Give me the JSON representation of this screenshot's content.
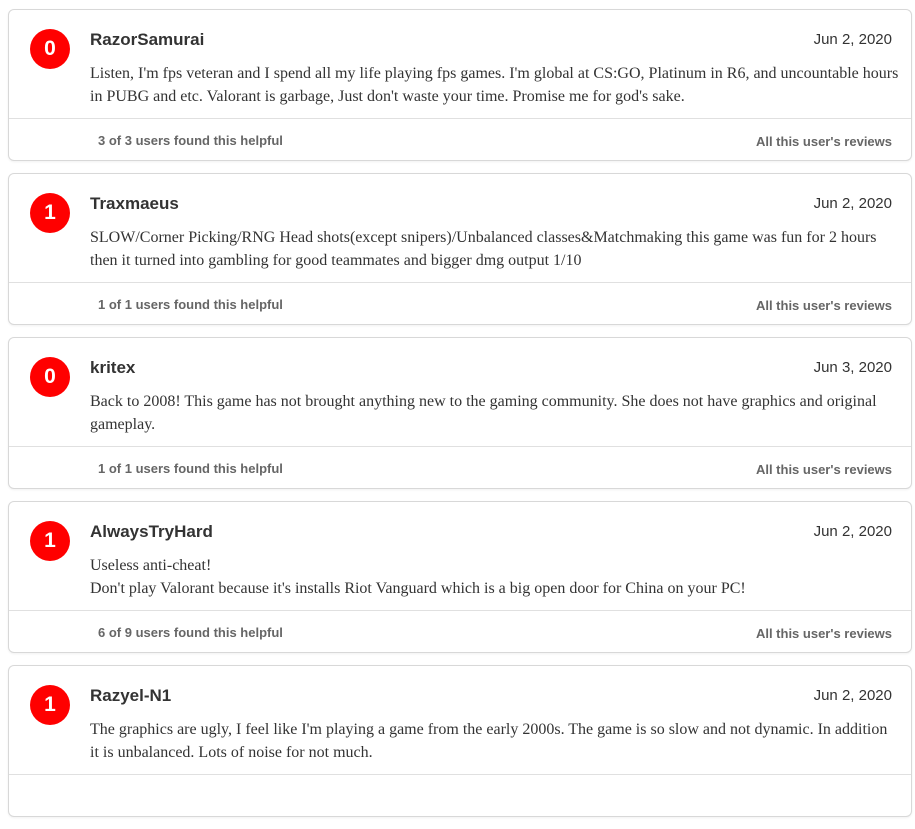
{
  "reviews": [
    {
      "score": "0",
      "author": "RazorSamurai",
      "date": "Jun 2, 2020",
      "body": "Listen, I'm fps veteran and I spend all my life playing fps games. I'm global at CS:GO, Platinum in R6, and uncountable hours in PUBG and etc. Valorant is garbage, Just don't waste your time. Promise me for god's sake.",
      "helpful": "3 of 3 users found this helpful",
      "all_reviews": "All this user's reviews"
    },
    {
      "score": "1",
      "author": "Traxmaeus",
      "date": "Jun 2, 2020",
      "body": "SLOW/Corner Picking/RNG Head shots(except snipers)/Unbalanced classes&Matchmaking this game was fun for 2 hours then it turned into gambling for good teammates and bigger dmg output 1/10",
      "helpful": "1 of 1 users found this helpful",
      "all_reviews": "All this user's reviews"
    },
    {
      "score": "0",
      "author": "kritex",
      "date": "Jun 3, 2020",
      "body": "Back to 2008! This game has not brought anything new to the gaming community. She does not have graphics and original gameplay.",
      "helpful": "1 of 1 users found this helpful",
      "all_reviews": "All this user's reviews"
    },
    {
      "score": "1",
      "author": "AlwaysTryHard",
      "date": "Jun 2, 2020",
      "body": "Useless anti-cheat!\nDon't play Valorant because it's installs Riot Vanguard which is a big open door for China on your PC!",
      "helpful": "6 of 9 users found this helpful",
      "all_reviews": "All this user's reviews"
    },
    {
      "score": "1",
      "author": "Razyel-N1",
      "date": "Jun 2, 2020",
      "body": "The graphics are ugly, I feel like I'm playing a game from the early 2000s. The game is so slow and not dynamic. In addition it is unbalanced. Lots of noise for not much.",
      "helpful": "",
      "all_reviews": ""
    }
  ],
  "colors": {
    "score_negative": "#ff0000",
    "text": "#333333",
    "muted": "#666666",
    "border": "#d8d8d8"
  }
}
